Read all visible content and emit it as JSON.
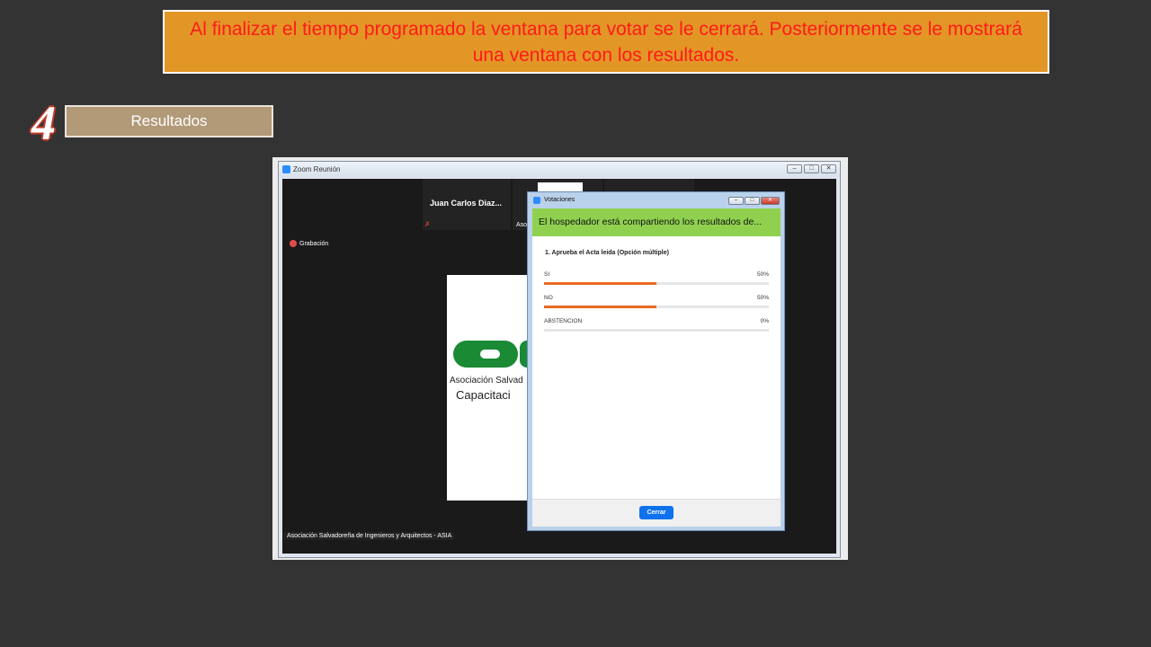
{
  "banner": {
    "text": "Al finalizar el tiempo programado la ventana para votar se le cerrará. Posteriormente se le mostrará una ventana con los resultados."
  },
  "step": {
    "number": "4",
    "label": "Resultados"
  },
  "zoom": {
    "window_title": "Zoom Reunión",
    "participant_name": "Juan Carlos Diaz...",
    "participant_2_name": "Aso",
    "recording_label": "Grabación",
    "slide_text_1": "Asociación Salvad",
    "slide_text_2": "Capacitaci",
    "host_name": "Asociación Salvadoreña de Ingenieros y Arquitectos - ASIA"
  },
  "poll": {
    "window_title": "Votaciones",
    "banner": "El hospedador está compartiendo los resultados de...",
    "question": "1. Aprueba el Acta leida (Opción múltiple)",
    "options": [
      {
        "label": "SI",
        "percent_text": "50%",
        "percent": 50
      },
      {
        "label": "NO",
        "percent_text": "50%",
        "percent": 50
      },
      {
        "label": "ABSTENCION",
        "percent_text": "0%",
        "percent": 0
      }
    ],
    "close_label": "Cerrar"
  },
  "colors": {
    "banner_bg": "#e29626",
    "banner_text": "#ff1a1a",
    "poll_banner": "#8fd14f",
    "bar_fill": "#ea6a21",
    "close_button": "#0e72ed"
  },
  "icons": {
    "zoom_app": "zoom-logo-icon",
    "recording": "record-dot-icon",
    "muted_mic": "muted-mic-icon"
  }
}
